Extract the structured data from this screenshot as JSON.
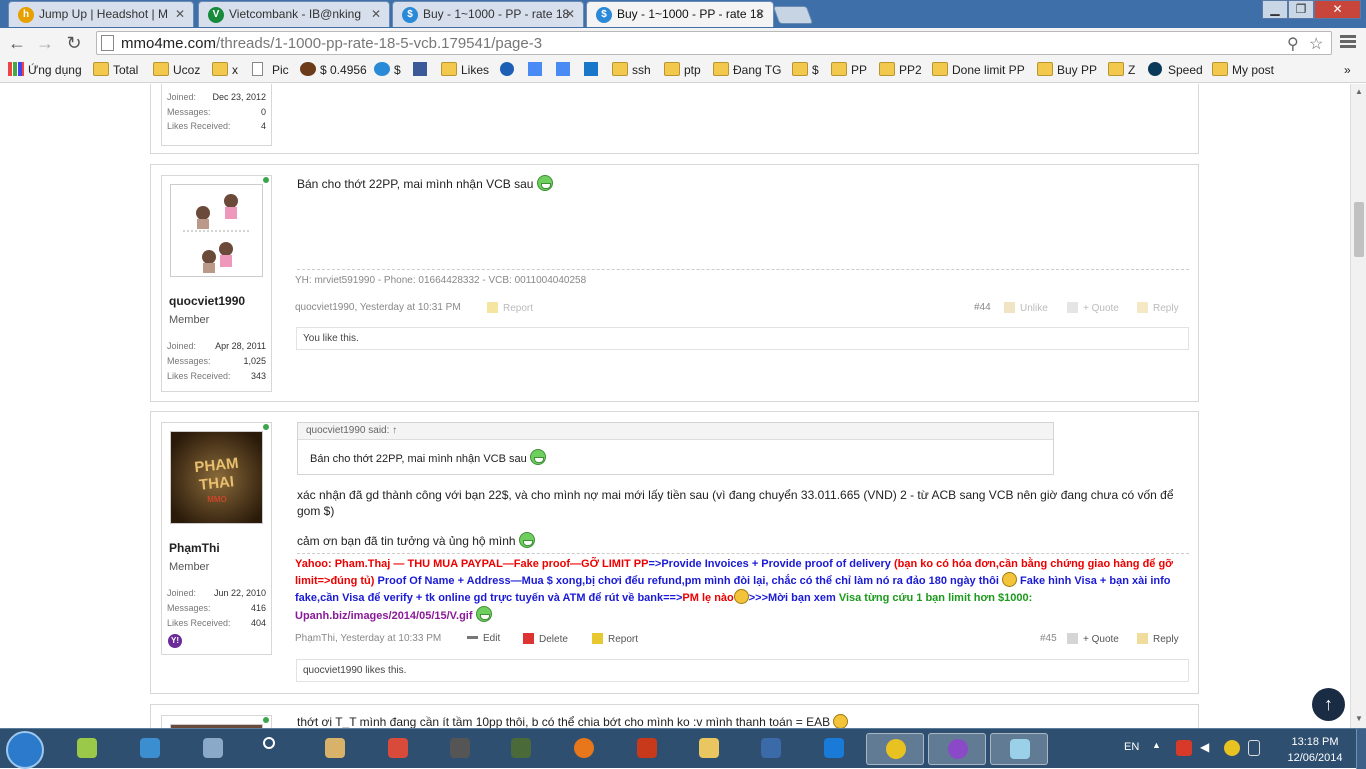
{
  "browser": {
    "tabs": [
      {
        "label": "Jump Up | Headshot | M",
        "icon": "hs-favicon",
        "icon_color": "#e8a000"
      },
      {
        "label": "Vietcombank - IB@nking",
        "icon": "shield-favicon",
        "icon_color": "#178a3c"
      },
      {
        "label": "Buy - 1~1000 - PP - rate 18",
        "icon": "mmo4me-favicon",
        "icon_color": "#2a8ad8"
      },
      {
        "label": "Buy - 1~1000 - PP - rate 18",
        "icon": "mmo4me-favicon",
        "icon_color": "#2a8ad8"
      }
    ],
    "url_domain": "mmo4me.com",
    "url_path": "/threads/1-1000-pp-rate-18-5-vcb.179541/page-3",
    "bookmarks": [
      {
        "label": "Ứng dụng",
        "icon": "apps-grid-icon"
      },
      {
        "label": "Total",
        "icon": "folder-icon"
      },
      {
        "label": "Ucoz",
        "icon": "folder-icon"
      },
      {
        "label": "x",
        "icon": "folder-icon"
      },
      {
        "label": "Pic",
        "icon": "page-icon"
      },
      {
        "label": "$ 0.4956",
        "icon": "coin-icon"
      },
      {
        "label": "$",
        "icon": "skype-icon"
      },
      {
        "label": "",
        "icon": "facebook-icon"
      },
      {
        "label": "Likes",
        "icon": "folder-icon"
      },
      {
        "label": "",
        "icon": "alexa-icon"
      },
      {
        "label": "",
        "icon": "translate-icon"
      },
      {
        "label": "",
        "icon": "google-icon"
      },
      {
        "label": "",
        "icon": "ip-icon"
      },
      {
        "label": "ssh",
        "icon": "folder-icon"
      },
      {
        "label": "ptp",
        "icon": "folder-icon"
      },
      {
        "label": "Đang TG",
        "icon": "folder-icon"
      },
      {
        "label": "$",
        "icon": "folder-icon"
      },
      {
        "label": "PP",
        "icon": "folder-icon"
      },
      {
        "label": "PP2",
        "icon": "folder-icon"
      },
      {
        "label": "Done limit PP",
        "icon": "folder-icon"
      },
      {
        "label": "Buy PP",
        "icon": "folder-icon"
      },
      {
        "label": "Z",
        "icon": "folder-icon"
      },
      {
        "label": "Speed",
        "icon": "speedometer-icon"
      },
      {
        "label": "My post",
        "icon": "folder-icon"
      }
    ],
    "overflow": "»"
  },
  "post_prev": {
    "joined_label": "Joined:",
    "joined": "Dec 23, 2012",
    "messages_label": "Messages:",
    "messages": "0",
    "likes_label": "Likes Received:",
    "likes": "4"
  },
  "post44": {
    "username": "quocviet1990",
    "user_title": "Member",
    "joined_label": "Joined:",
    "joined": "Apr 28, 2011",
    "messages_label": "Messages:",
    "messages": "1,025",
    "likes_label": "Likes Received:",
    "likes": "343",
    "message": "Bán cho thớt 22PP, mai mình nhận VCB sau",
    "signature": "YH: mrviet591990 - Phone: 01664428332 - VCB: 0011004040258",
    "meta": "quocviet1990, Yesterday at 10:31 PM",
    "report": "Report",
    "number": "#44",
    "unlike": "Unlike",
    "quote": "+ Quote",
    "reply": "Reply",
    "likes_text": "You like this."
  },
  "post45": {
    "username": "PhạmThi",
    "user_title": "Member",
    "avatar_text": "PHAM THAI",
    "avatar_sub": "MMO",
    "joined_label": "Joined:",
    "joined": "Jun 22, 2010",
    "messages_label": "Messages:",
    "messages": "416",
    "likes_label": "Likes Received:",
    "likes": "404",
    "quote_header": "quocviet1990 said: ↑",
    "quote_body": "Bán cho thớt 22PP, mai mình nhận VCB sau",
    "message1": "xác nhận đã gd thành công với bạn 22$, và cho mình nợ mai mới lấy tiền sau (vì đang chuyển 33.011.665 (VND) 2 - từ ACB sang VCB nên giờ đang chưa có vốn để gom $)",
    "message2": "cảm ơn bạn đã tin tưởng và ủng hộ mình",
    "sig": {
      "s1": "Yahoo: Pham.Thaj",
      "s2": " — THU MUA PAYPAL—Fake proof—GỠ LIMIT PP",
      "s3": "=>Provide Invoices + Provide proof of delivery",
      "s4": " (bạn ko có hóa đơn,cần bằng chứng giao hàng để gỡ limit=>đúng tủ)",
      "s5": " Proof Of Name + Address—Mua $ xong,bị chơi đểu refund,pm mình đòi lại, chắc có thể chỉ làm nó ra đảo 180 ngày thôi ",
      "s6": " Fake hình Visa + bạn xài info fake,cần Visa để verify + tk online gd trực tuyến và ATM để rút về bank==>",
      "s7": "PM lẹ nào",
      "s8": ">>>Mời bạn xem ",
      "s9": "Visa từng cứu 1 bạn limit hơn $1000:",
      "s10": " Upanh.biz/images/2014/05/15/V.gif "
    },
    "meta": "PhạmThi, Yesterday at 10:33 PM",
    "edit": "Edit",
    "delete": "Delete",
    "report": "Report",
    "number": "#45",
    "quote": "+ Quote",
    "reply": "Reply",
    "likes_text": "quocviet1990 likes this."
  },
  "post46": {
    "message": "thớt ơi T_T mình đang cần ít tầm 10pp thôi, b có thể chia bớt cho mình ko :v mình thanh toán = EAB"
  },
  "taskbar": {
    "lang": "EN",
    "time": "13:18 PM",
    "date": "12/06/2014"
  }
}
